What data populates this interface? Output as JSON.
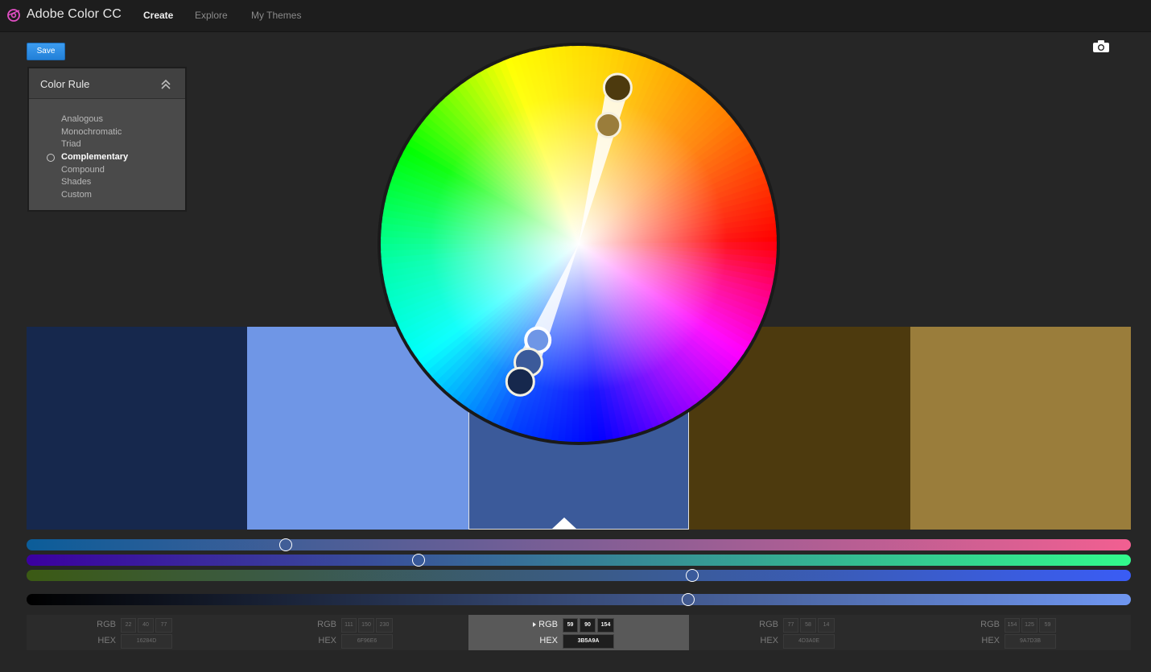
{
  "app": {
    "title": "Adobe Color CC"
  },
  "nav": {
    "items": [
      "Create",
      "Explore",
      "My Themes"
    ],
    "active": "Create"
  },
  "toolbar": {
    "save_label": "Save"
  },
  "color_rule": {
    "title": "Color Rule",
    "options": [
      "Analogous",
      "Monochromatic",
      "Triad",
      "Complementary",
      "Compound",
      "Shades",
      "Custom"
    ],
    "selected": "Complementary"
  },
  "swatches": [
    {
      "hex": "16284D",
      "rgb": [
        22,
        40,
        77
      ]
    },
    {
      "hex": "6F96E6",
      "rgb": [
        111,
        150,
        230
      ]
    },
    {
      "hex": "3B5A9A",
      "rgb": [
        59,
        90,
        154
      ]
    },
    {
      "hex": "4D3A0E",
      "rgb": [
        77,
        58,
        14
      ]
    },
    {
      "hex": "9A7D3B",
      "rgb": [
        154,
        125,
        59
      ]
    }
  ],
  "active_swatch": 2,
  "fields": {
    "rgb_label": "RGB",
    "hex_label": "HEX"
  },
  "sliders": {
    "r": {
      "value": 59,
      "max": 255,
      "gradient": [
        "#0b5d99",
        "#f25f91"
      ]
    },
    "g": {
      "value": 90,
      "max": 255,
      "gradient": [
        "#3b00a0",
        "#32fa8c"
      ]
    },
    "b": {
      "value": 154,
      "max": 255,
      "gradient": [
        "#3b5a14",
        "#3a5cf5"
      ]
    },
    "brightness": {
      "value": 0.6,
      "gradient": [
        "#000000",
        "#6f96f0"
      ]
    }
  },
  "wheel_markers": [
    {
      "hex": "4D3A0E",
      "hue_deg": 22
    },
    {
      "hex": "9A7D3B",
      "hue_deg": 22
    },
    {
      "hex": "6F96E6",
      "hue_deg": 202
    },
    {
      "hex": "3B5A9A",
      "hue_deg": 202
    },
    {
      "hex": "16284D",
      "hue_deg": 202
    }
  ]
}
